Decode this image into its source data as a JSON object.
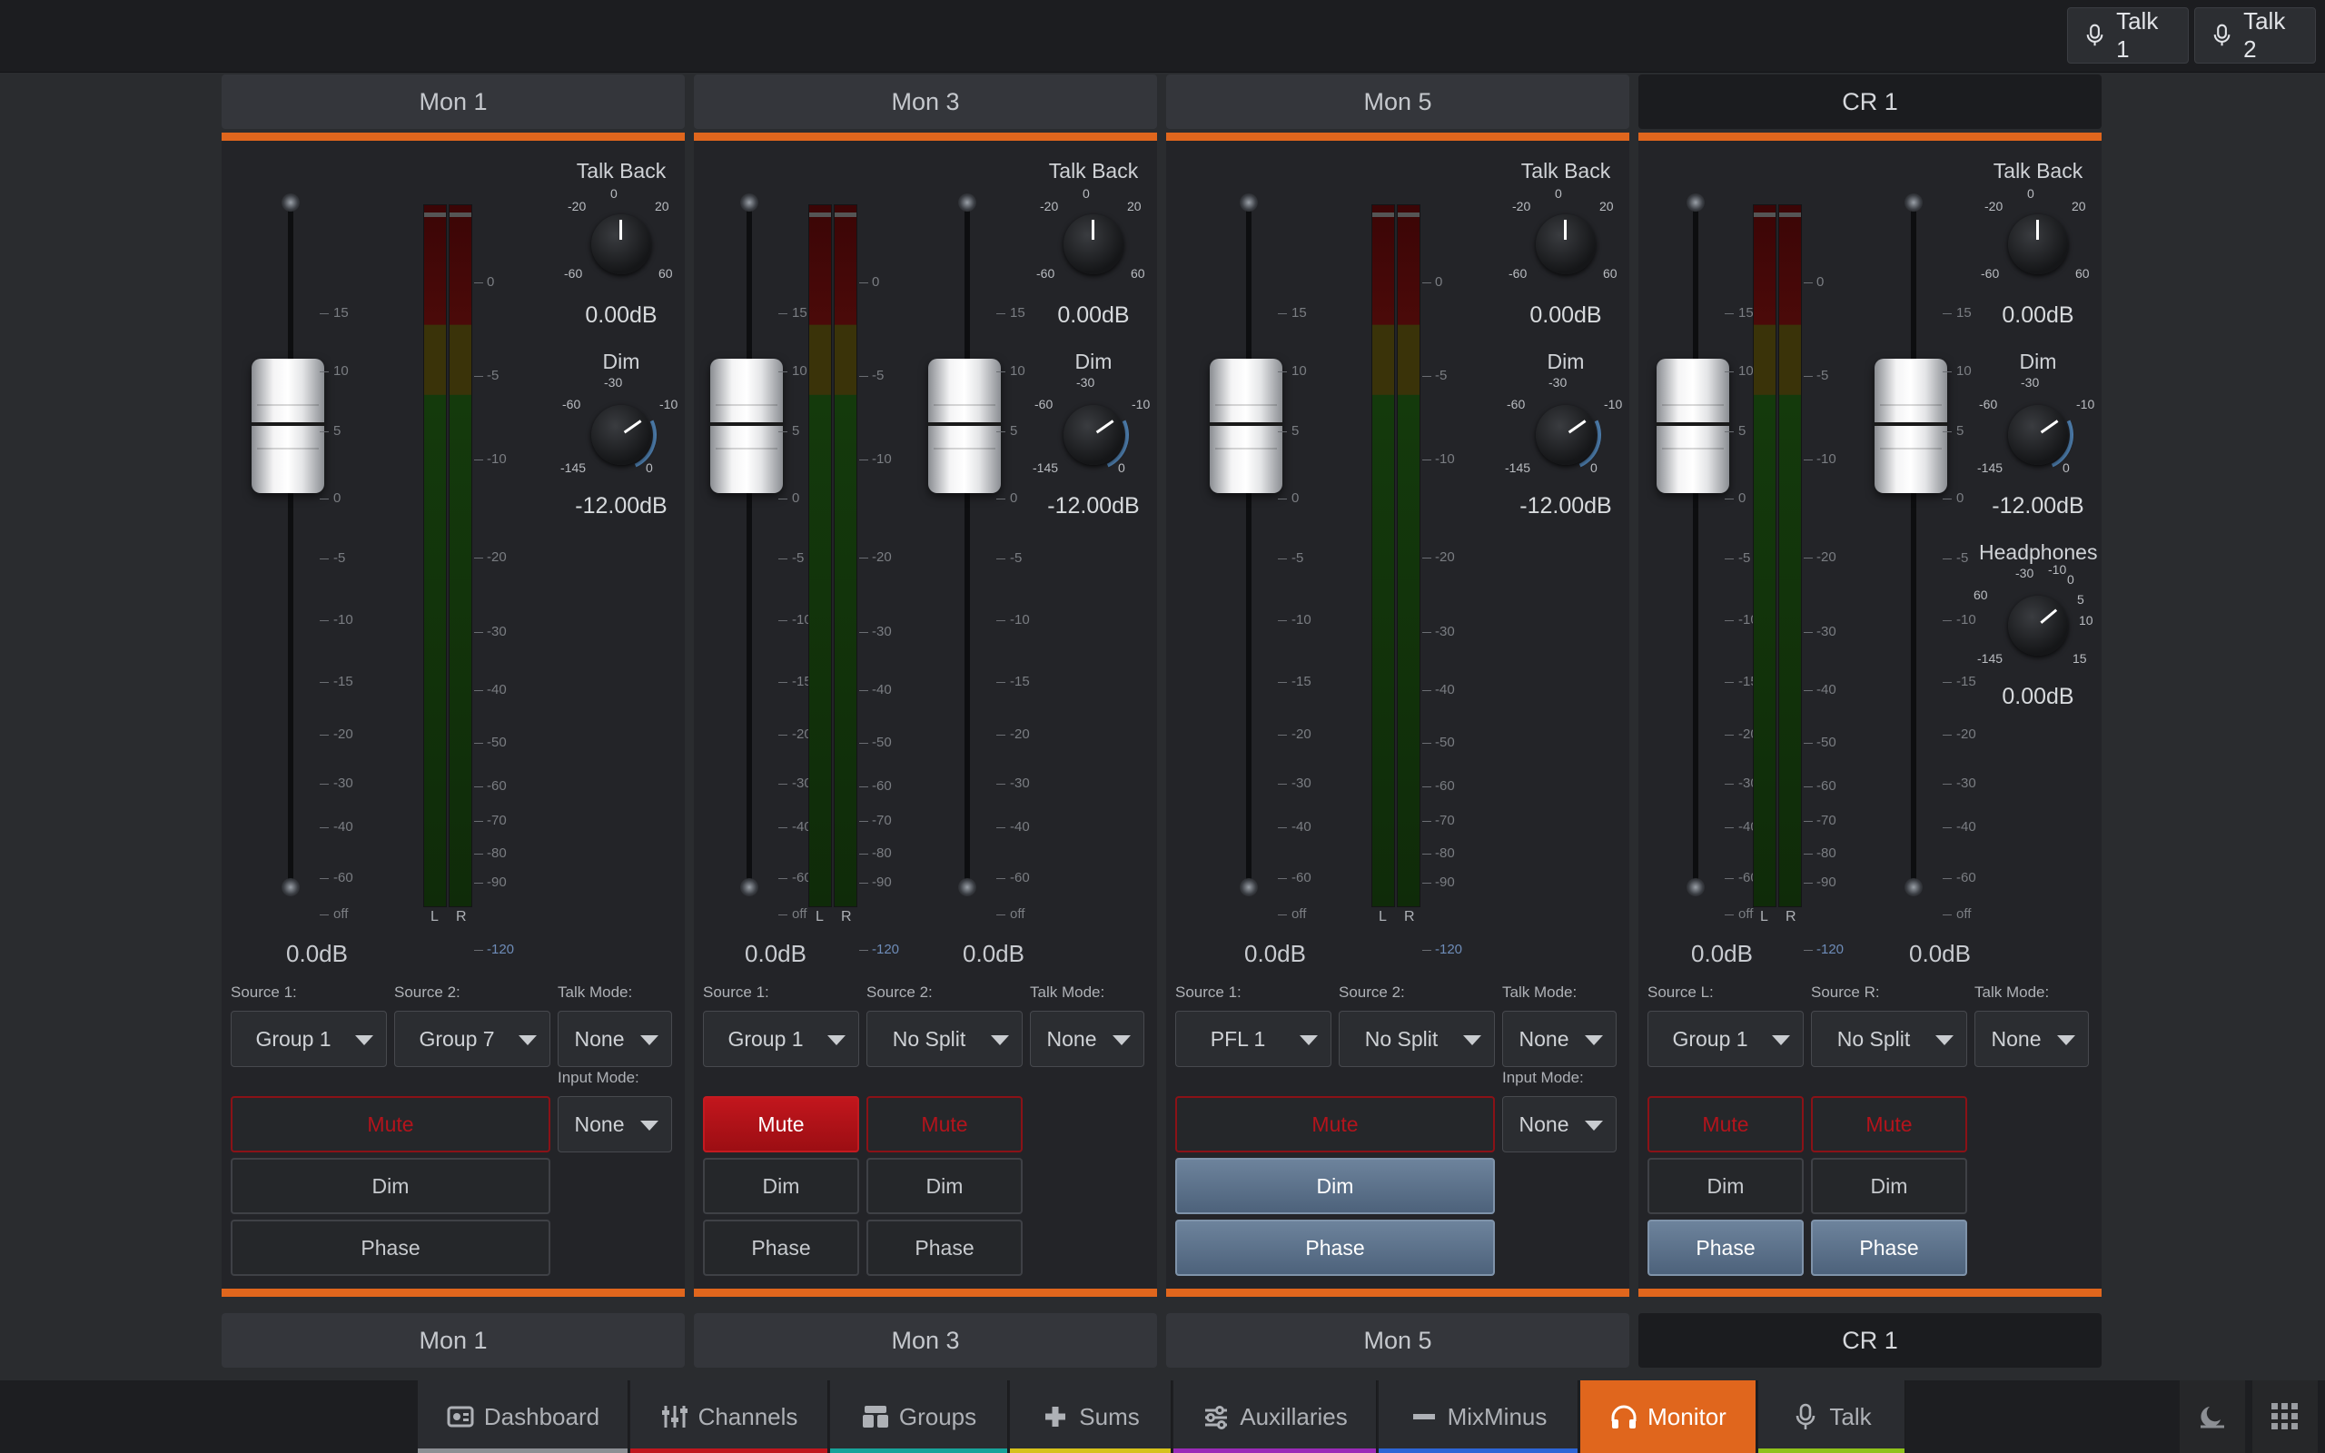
{
  "talk_buttons": [
    {
      "label": "Talk 1"
    },
    {
      "label": "Talk 2"
    }
  ],
  "colors": {
    "accent": "#e0661d",
    "mute": "#c2161d",
    "active": "#5a6f88"
  },
  "fader_ticks": [
    "15",
    "10",
    "5",
    "0",
    "-5",
    "-10",
    "-15",
    "-20",
    "-30",
    "-40",
    "-60",
    "off"
  ],
  "meter_ticks": [
    "0",
    "-5",
    "-10",
    "-20",
    "-30",
    "-40",
    "-50",
    "-60",
    "-70",
    "-80",
    "-90",
    "-120"
  ],
  "meter_channels": [
    "L",
    "R"
  ],
  "knob_scales": {
    "talkback": [
      "-20",
      "0",
      "20",
      "-60",
      "60"
    ],
    "dim": [
      "-30",
      "-60",
      "-10",
      "-145",
      "0"
    ],
    "headphones": [
      "-30",
      "-10",
      "60",
      "0",
      "5",
      "10",
      "-145",
      "15"
    ]
  },
  "strips": [
    {
      "header": "Mon 1",
      "footer": "Mon 1",
      "faders": [
        {
          "value": "0.0dB"
        }
      ],
      "talkback": {
        "label": "Talk Back",
        "value": "0.00dB",
        "level": 0
      },
      "dim": {
        "label": "Dim",
        "value": "-12.00dB",
        "level": -12
      },
      "selects": [
        {
          "label": "Source 1:",
          "value": "Group 1"
        },
        {
          "label": "Source 2:",
          "value": "Group 7"
        },
        {
          "label": "Talk Mode:",
          "value": "None"
        }
      ],
      "input_mode": {
        "label": "Input Mode:",
        "value": "None"
      },
      "mute": [
        {
          "label": "Mute",
          "on": false
        }
      ],
      "dim_buttons": [
        {
          "label": "Dim",
          "active": false
        }
      ],
      "phase": [
        {
          "label": "Phase",
          "active": false
        }
      ]
    },
    {
      "header": "Mon 3",
      "footer": "Mon 3",
      "faders": [
        {
          "value": "0.0dB"
        },
        {
          "value": "0.0dB"
        }
      ],
      "talkback": {
        "label": "Talk Back",
        "value": "0.00dB",
        "level": 0
      },
      "dim": {
        "label": "Dim",
        "value": "-12.00dB",
        "level": -12
      },
      "selects": [
        {
          "label": "Source 1:",
          "value": "Group 1"
        },
        {
          "label": "Source 2:",
          "value": "No Split"
        },
        {
          "label": "Talk Mode:",
          "value": "None"
        }
      ],
      "mute": [
        {
          "label": "Mute",
          "on": true
        },
        {
          "label": "Mute",
          "on": false
        }
      ],
      "dim_buttons": [
        {
          "label": "Dim",
          "active": false
        },
        {
          "label": "Dim",
          "active": false
        }
      ],
      "phase": [
        {
          "label": "Phase",
          "active": false
        },
        {
          "label": "Phase",
          "active": false
        }
      ]
    },
    {
      "header": "Mon 5",
      "footer": "Mon 5",
      "faders": [
        {
          "value": "0.0dB"
        }
      ],
      "talkback": {
        "label": "Talk Back",
        "value": "0.00dB",
        "level": 0
      },
      "dim": {
        "label": "Dim",
        "value": "-12.00dB",
        "level": -12
      },
      "selects": [
        {
          "label": "Source 1:",
          "value": "PFL 1"
        },
        {
          "label": "Source 2:",
          "value": "No Split"
        },
        {
          "label": "Talk Mode:",
          "value": "None"
        }
      ],
      "input_mode": {
        "label": "Input Mode:",
        "value": "None"
      },
      "mute": [
        {
          "label": "Mute",
          "on": false
        }
      ],
      "dim_buttons": [
        {
          "label": "Dim",
          "active": true
        }
      ],
      "phase": [
        {
          "label": "Phase",
          "active": true
        }
      ]
    },
    {
      "header": "CR 1",
      "footer": "CR 1",
      "faders": [
        {
          "value": "0.0dB"
        },
        {
          "value": "0.0dB"
        }
      ],
      "talkback": {
        "label": "Talk Back",
        "value": "0.00dB",
        "level": 0
      },
      "dim": {
        "label": "Dim",
        "value": "-12.00dB",
        "level": -12
      },
      "headphones": {
        "label": "Headphones",
        "value": "0.00dB",
        "level": 0
      },
      "selects": [
        {
          "label": "Source L:",
          "value": "Group 1"
        },
        {
          "label": "Source R:",
          "value": "No Split"
        },
        {
          "label": "Talk Mode:",
          "value": "None"
        }
      ],
      "mute": [
        {
          "label": "Mute",
          "on": false
        },
        {
          "label": "Mute",
          "on": false
        }
      ],
      "dim_buttons": [
        {
          "label": "Dim",
          "active": false
        },
        {
          "label": "Dim",
          "active": false
        }
      ],
      "phase": [
        {
          "label": "Phase",
          "active": true
        },
        {
          "label": "Phase",
          "active": true
        }
      ]
    }
  ],
  "nav": [
    {
      "label": "Dashboard",
      "icon": "dashboard-icon",
      "color": "#8c8f94"
    },
    {
      "label": "Channels",
      "icon": "channels-icon",
      "color": "#c0171e"
    },
    {
      "label": "Groups",
      "icon": "groups-icon",
      "color": "#17a39a"
    },
    {
      "label": "Sums",
      "icon": "sums-icon",
      "color": "#d6c21b"
    },
    {
      "label": "Auxillaries",
      "icon": "auxillaries-icon",
      "color": "#9b2bb8"
    },
    {
      "label": "MixMinus",
      "icon": "mixminus-icon",
      "color": "#2d66d6"
    },
    {
      "label": "Monitor",
      "icon": "headphones-icon",
      "color": "#e0661d",
      "selected": true
    },
    {
      "label": "Talk",
      "icon": "microphone-icon",
      "color": "#8fc21b"
    }
  ],
  "corner_icons": [
    "night-mode-icon",
    "apps-grid-icon"
  ]
}
